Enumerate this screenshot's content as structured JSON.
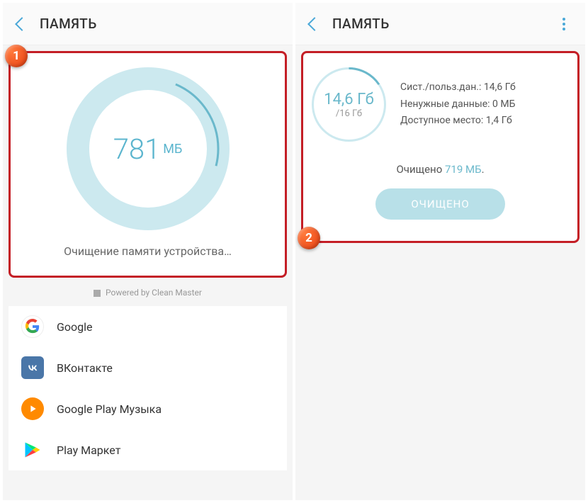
{
  "left": {
    "title": "ПАМЯТЬ",
    "badge": "1",
    "ring": {
      "value": "781",
      "unit": "МБ"
    },
    "status": "Очищение памяти устройства…",
    "powered": "Powered by Clean Master",
    "apps": [
      {
        "name": "Google"
      },
      {
        "name": "ВКонтакте"
      },
      {
        "name": "Google Play Музыка"
      },
      {
        "name": "Play Маркет"
      }
    ]
  },
  "right": {
    "title": "ПАМЯТЬ",
    "badge": "2",
    "storage": {
      "used": "14,6 Гб",
      "total": "/16 Гб"
    },
    "info": {
      "sys": "Сист./польз.дан.: 14,6 Гб",
      "junk": "Ненужные данные: 0 МБ",
      "avail": "Доступное место: 1,4 Гб"
    },
    "cleaned_prefix": "Очищено ",
    "cleaned_amount": "719 МБ",
    "cleaned_suffix": ".",
    "button": "ОЧИЩЕНО"
  }
}
